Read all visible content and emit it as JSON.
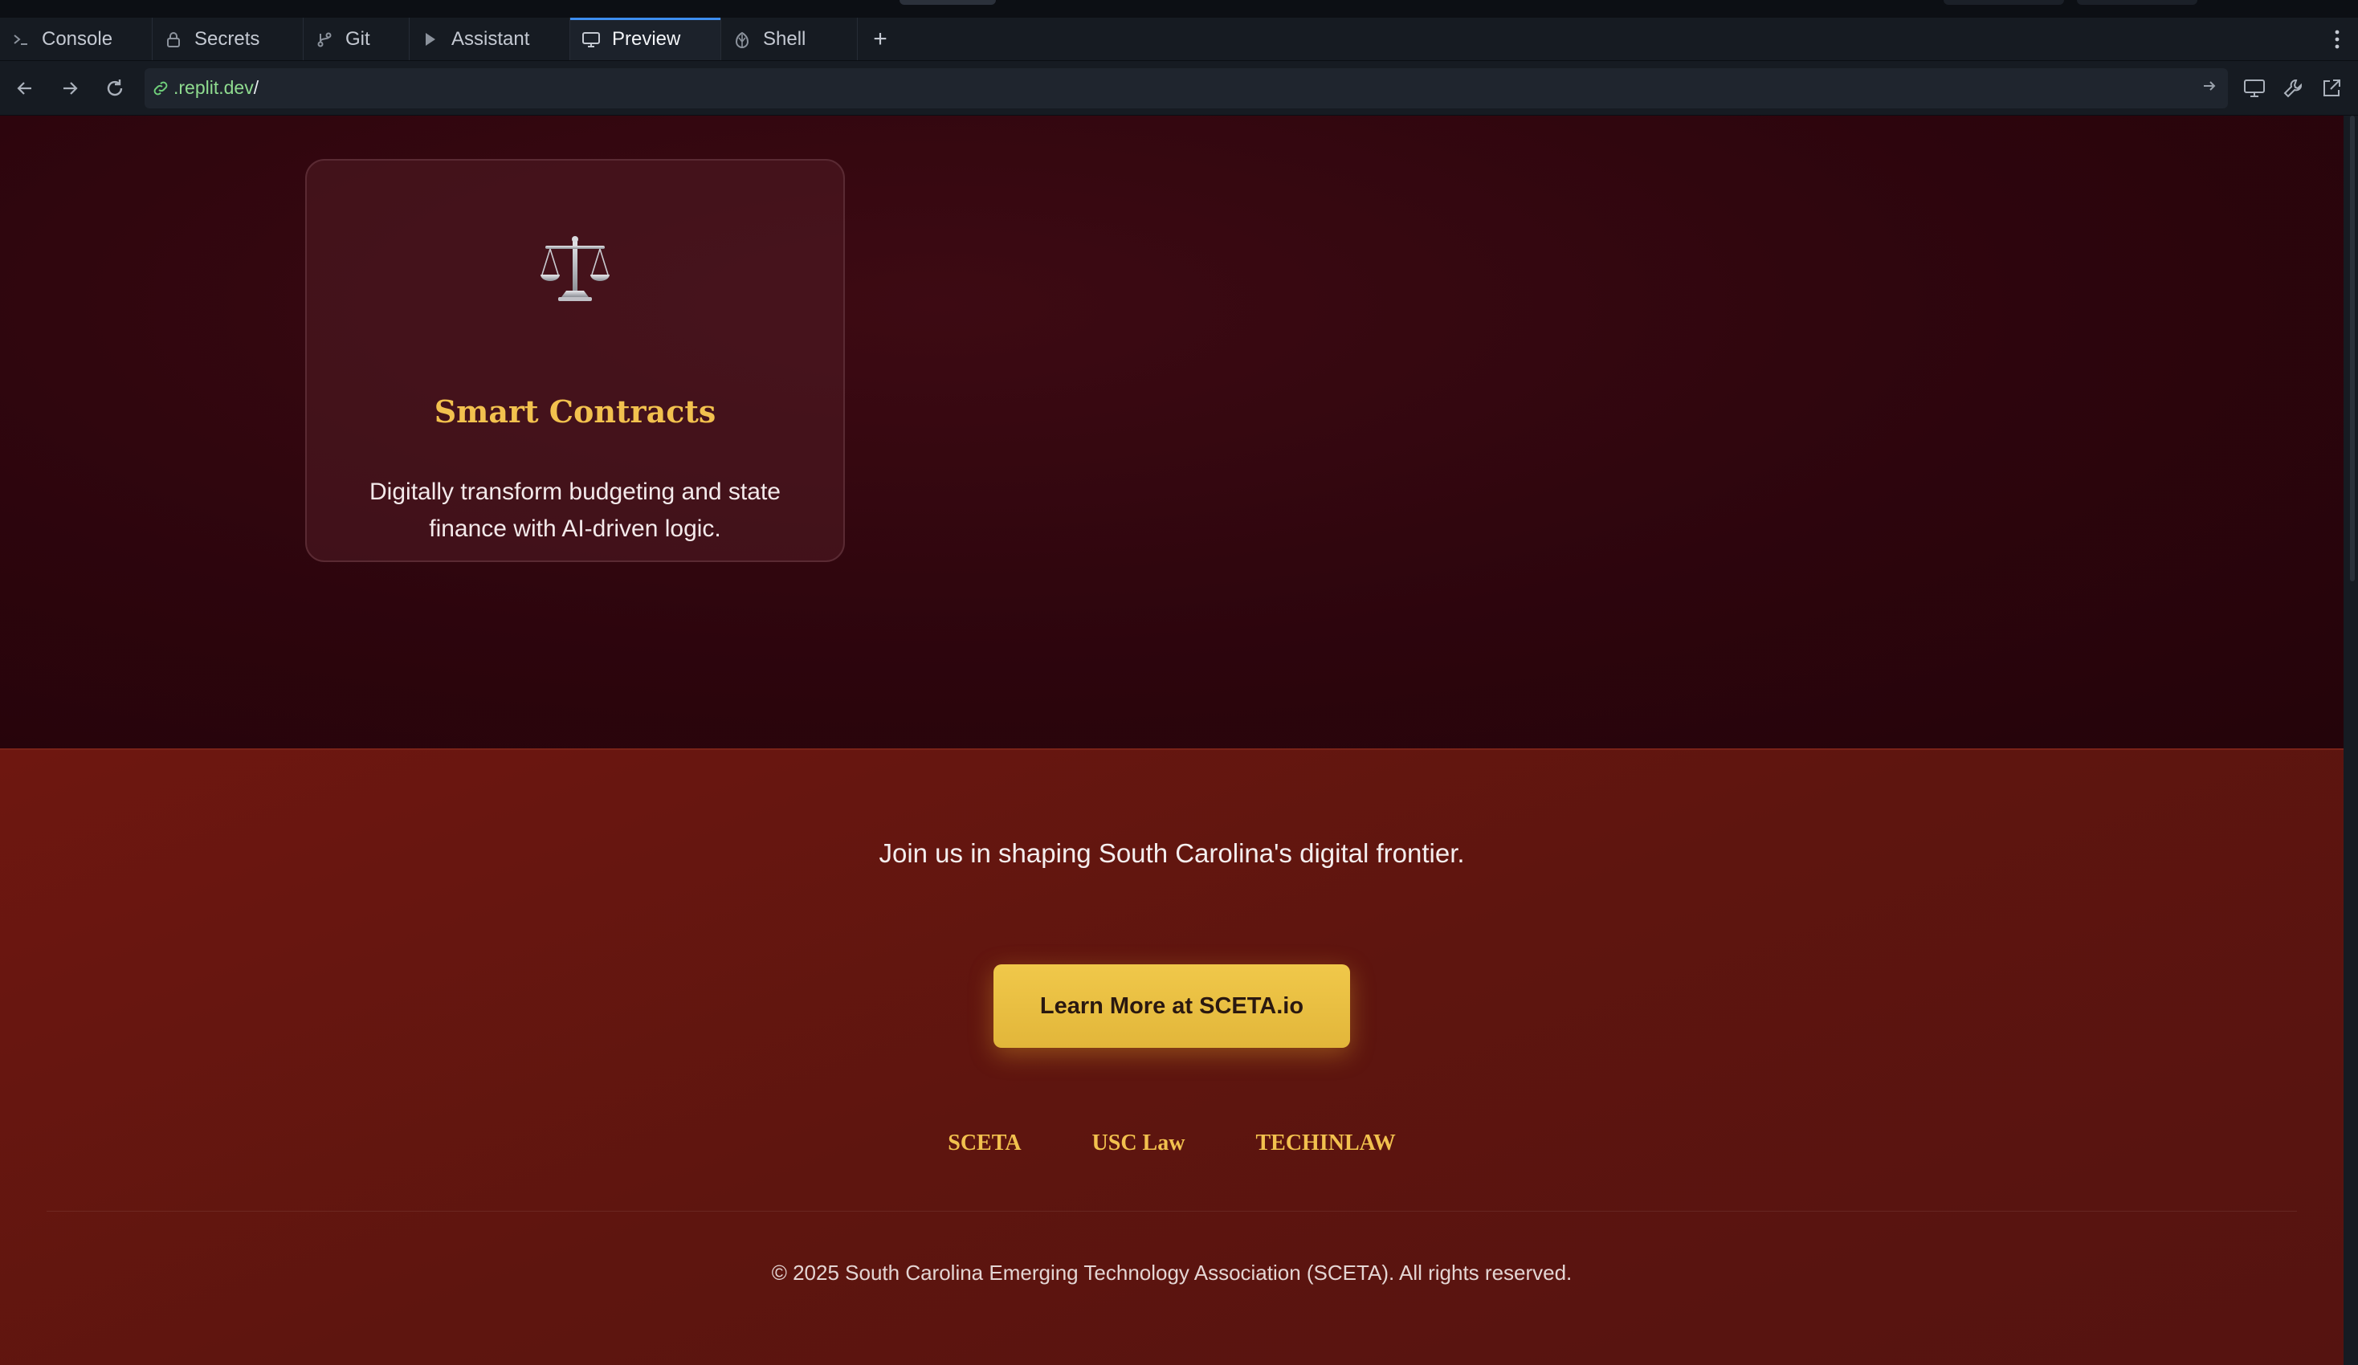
{
  "tabs": [
    {
      "label": "Console",
      "icon": "terminal-icon",
      "active": false
    },
    {
      "label": "Secrets",
      "icon": "lock-icon",
      "active": false
    },
    {
      "label": "Git",
      "icon": "git-branch-icon",
      "active": false
    },
    {
      "label": "Assistant",
      "icon": "assistant-icon",
      "active": false
    },
    {
      "label": "Preview",
      "icon": "monitor-icon",
      "active": true
    },
    {
      "label": "Shell",
      "icon": "shell-icon",
      "active": false
    }
  ],
  "add_tab_label": "+",
  "address": {
    "host": ".replit.dev",
    "path": "/"
  },
  "card": {
    "emoji": "⚖️",
    "title": "Smart Contracts",
    "description": "Digitally transform budgeting and state finance with AI-driven logic."
  },
  "footer": {
    "join_text": "Join us in shaping South Carolina's digital frontier.",
    "cta_label": "Learn More at SCETA.io",
    "links": [
      "SCETA",
      "USC Law",
      "TECHINLAW"
    ],
    "copyright": "© 2025 South Carolina Emerging Technology Association (SCETA). All rights reserved."
  },
  "colors": {
    "accent_gold": "#f2c14e",
    "hero_bg": "#2d050d",
    "footer_bg": "#5e150f",
    "active_tab_indicator": "#3d8ef0"
  }
}
